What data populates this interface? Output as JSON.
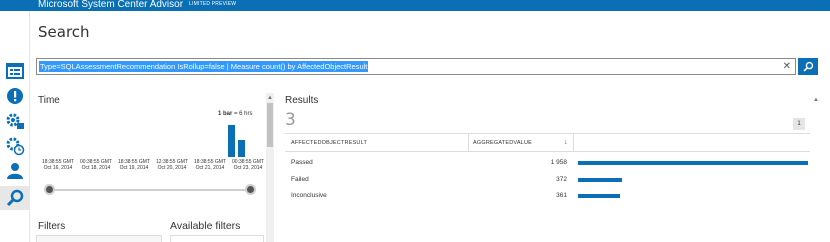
{
  "app": {
    "title": "Microsoft System Center Advisor",
    "tag": "LIMITED PREVIEW",
    "accent_color": "#0a6fb5"
  },
  "nav": [
    {
      "icon": "dashboard-icon",
      "active": false
    },
    {
      "icon": "alert-icon",
      "active": false
    },
    {
      "icon": "settings-icon",
      "active": false
    },
    {
      "icon": "settings-clock-icon",
      "active": false
    },
    {
      "icon": "user-icon",
      "active": false
    },
    {
      "icon": "search-icon",
      "active": true
    }
  ],
  "page": {
    "title": "Search"
  },
  "search": {
    "query": "Type=SQLAssessmentRecommendation IsRollup=false | Measure count() by AffectedObjectResult",
    "clear_symbol": "✕"
  },
  "time": {
    "title": "Time",
    "bar_legend_bold": "1 bar",
    "bar_legend_rest": " = 6 hrs",
    "histogram": [
      {
        "label": "18:38:55 GMT\nOct 16, 2014",
        "value": 0
      },
      {
        "label": "00:38:55 GMT\nOct 18, 2014",
        "value": 0
      },
      {
        "label": "18:38:55 GMT\nOct 19, 2014",
        "value": 0
      },
      {
        "label": "12:38:55 GMT\nOct 20, 2014",
        "value": 0
      },
      {
        "label": "18:38:55 GMT\nOct 21, 2014",
        "value": 0
      },
      {
        "label": "00:38:55 GMT\nOct 23, 2014",
        "value": 0
      }
    ],
    "bars": [
      1.0,
      0.53
    ],
    "range": {
      "start": 0,
      "end": 1
    }
  },
  "filters": {
    "title": "Filters",
    "available_title": "Available filters"
  },
  "results": {
    "title": "Results",
    "count": "3",
    "page": "1",
    "columns": [
      {
        "label": "AFFECTEDOBJECTRESULT"
      },
      {
        "label": "AGGREGATEDVALUE"
      }
    ],
    "sort_symbol": "↓",
    "rows": [
      {
        "name": "Passed",
        "value": "1 958",
        "fraction": 1.0
      },
      {
        "name": "Failed",
        "value": "372",
        "fraction": 0.19
      },
      {
        "name": "Inconclusive",
        "value": "361",
        "fraction": 0.184
      }
    ]
  }
}
